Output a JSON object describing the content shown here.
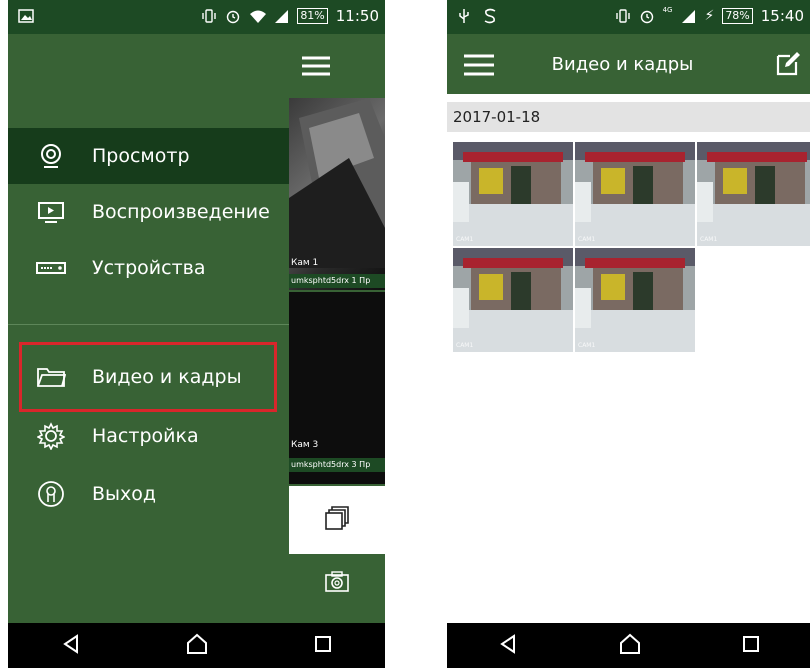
{
  "left_screen": {
    "status_bar": {
      "battery": "81%",
      "time": "11:50"
    },
    "drawer": {
      "items": [
        {
          "label": "Просмотр",
          "icon": "webcam-icon",
          "active": true
        },
        {
          "label": "Воспроизведение",
          "icon": "playback-icon",
          "active": false
        },
        {
          "label": "Устройства",
          "icon": "device-icon",
          "active": false
        },
        {
          "label": "Видео и кадры",
          "icon": "folder-icon",
          "active": false
        },
        {
          "label": "Настройка",
          "icon": "gear-icon",
          "active": false
        },
        {
          "label": "Выход",
          "icon": "user-exit-icon",
          "active": false
        }
      ]
    },
    "behind_panel": {
      "cam1_label": "Кам 1",
      "cam1_sub": "umksphtd5drx 1 Пр",
      "cam3_label": "Кам 3",
      "cam3_sub": "umksphtd5drx 3 Пр"
    }
  },
  "right_screen": {
    "status_bar": {
      "network": "4G",
      "battery": "78%",
      "time": "15:40"
    },
    "app_bar": {
      "title": "Видео и кадры"
    },
    "date_header": "2017-01-18",
    "snapshots": [
      {
        "stamp": "CAM1"
      },
      {
        "stamp": "CAM1"
      },
      {
        "stamp": "CAM1"
      },
      {
        "stamp": "CAM1"
      },
      {
        "stamp": "CAM1"
      }
    ]
  },
  "colors": {
    "header_green": "#386235",
    "status_green": "#1d4a24",
    "active_item": "#163c1b",
    "highlight_red": "#d9262b"
  }
}
